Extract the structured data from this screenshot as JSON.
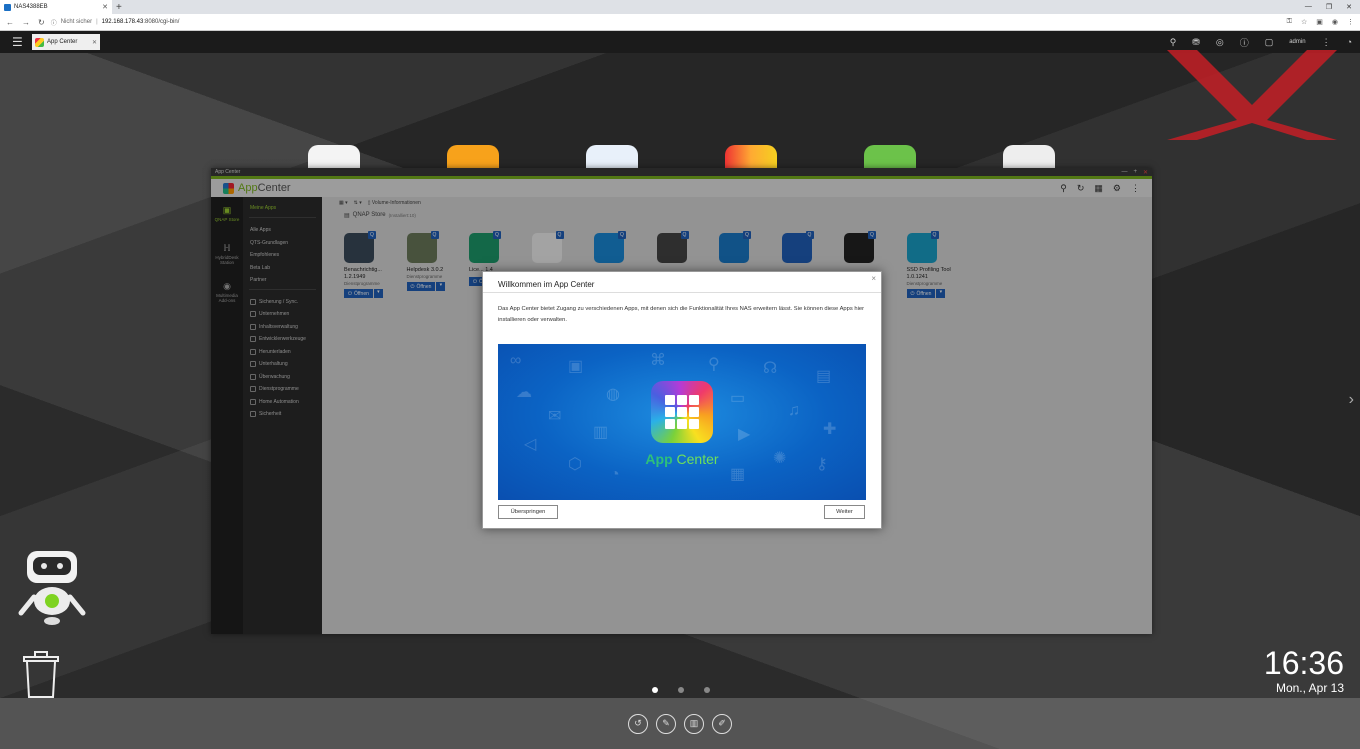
{
  "browser": {
    "tab_title": "NAS4388EB",
    "new_tab": "+",
    "security_label": "Nicht sicher",
    "url_host": "192.168.178.43",
    "url_rest": ":8080/cgi-bin/"
  },
  "qts": {
    "open_window_tab": "App Center",
    "user": "admin"
  },
  "window": {
    "title": "App Center",
    "brand_part1": "App",
    "brand_part2": "Center"
  },
  "rail": [
    {
      "label": "QNAP Store",
      "icon": "bag-icon"
    },
    {
      "label": "HybridDesk Station",
      "icon": "hd-icon"
    },
    {
      "label": "Multimedia Add-ons",
      "icon": "disc-icon"
    }
  ],
  "sidenav": {
    "my_apps": "Meine Apps",
    "items_a": [
      "Alle Apps",
      "QTS-Grundlagen",
      "Empfohlenes",
      "Beta Lab",
      "Partner"
    ],
    "items_b": [
      "Sicherung / Sync.",
      "Unternehmen",
      "Inhaltsverwaltung",
      "Entwicklerwerkzeuge",
      "Herunterladen",
      "Unterhaltung",
      "Überwachung",
      "Dienstprogramme",
      "Home Automation",
      "Sicherheit"
    ]
  },
  "toolbar": {
    "volume_info": "Volume-Informationen"
  },
  "store": {
    "title": "QNAP Store",
    "count": "(Installiert:10)"
  },
  "apps": [
    {
      "name": "Benachrichtig... 1.2.1949",
      "category": "Dienstprogramme",
      "open": "Öffnen"
    },
    {
      "name": "Helpdesk 3.0.2",
      "category": "Dienstprogramme",
      "open": "Öffnen"
    },
    {
      "name": "Lice... 1.4",
      "category": "",
      "open": "Ö"
    },
    {
      "name": "",
      "category": "",
      "open": ""
    },
    {
      "name": "",
      "category": "",
      "open": ""
    },
    {
      "name": "",
      "category": "",
      "open": ""
    },
    {
      "name": "",
      "category": "",
      "open": ""
    },
    {
      "name": "",
      "category": "",
      "open": ""
    },
    {
      "name": "",
      "category": "",
      "open": ""
    },
    {
      "name": "SSD Profiling Tool 1.0.1241",
      "category": "Dienstprogramme",
      "open": "Öffnen"
    }
  ],
  "modal": {
    "title": "Willkommen im App Center",
    "text": "Das App Center bietet Zugang zu verschiedenen Apps, mit denen sich die Funktionalität Ihres NAS erweitern lässt. Sie können diese Apps hier installieren oder verwalten.",
    "banner_part1": "App",
    "banner_part2": "Center",
    "skip": "Überspringen",
    "next": "Weiter",
    "close": "×"
  },
  "clock": {
    "time": "16:36",
    "date": "Mon., Apr 13"
  },
  "colors": {
    "accent_green": "#7ab21e",
    "primary_blue": "#1f5fb8"
  }
}
